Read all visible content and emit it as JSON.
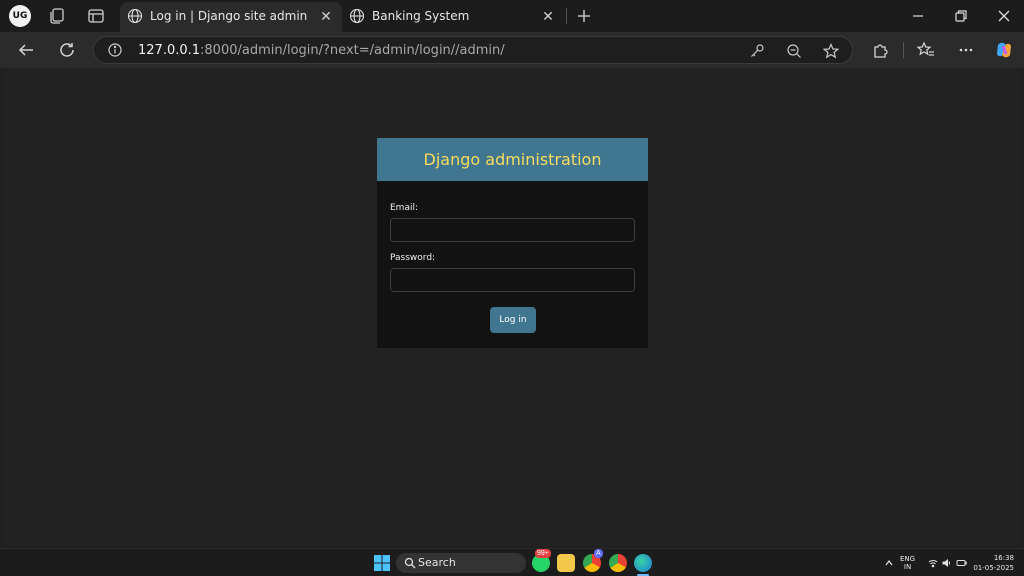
{
  "browser": {
    "profile_initials": "UG",
    "tabs": [
      {
        "title": "Log in | Django site admin",
        "active": true
      },
      {
        "title": "Banking System",
        "active": false
      }
    ],
    "url_host": "127.0.0.1",
    "url_rest": ":8000/admin/login/?next=/admin/login//admin/"
  },
  "login": {
    "header": "Django administration",
    "email_label": "Email:",
    "email_value": "",
    "password_label": "Password:",
    "password_value": "",
    "submit_label": "Log in"
  },
  "taskbar": {
    "search_label": "Search",
    "whatsapp_badge": "99+",
    "chrome_badge": "A",
    "lang_top": "ENG",
    "lang_bottom": "IN",
    "time": "16:38",
    "date": "01-05-2025"
  },
  "colors": {
    "django_blue": "#417690",
    "django_yellow": "#f5dd5d"
  }
}
